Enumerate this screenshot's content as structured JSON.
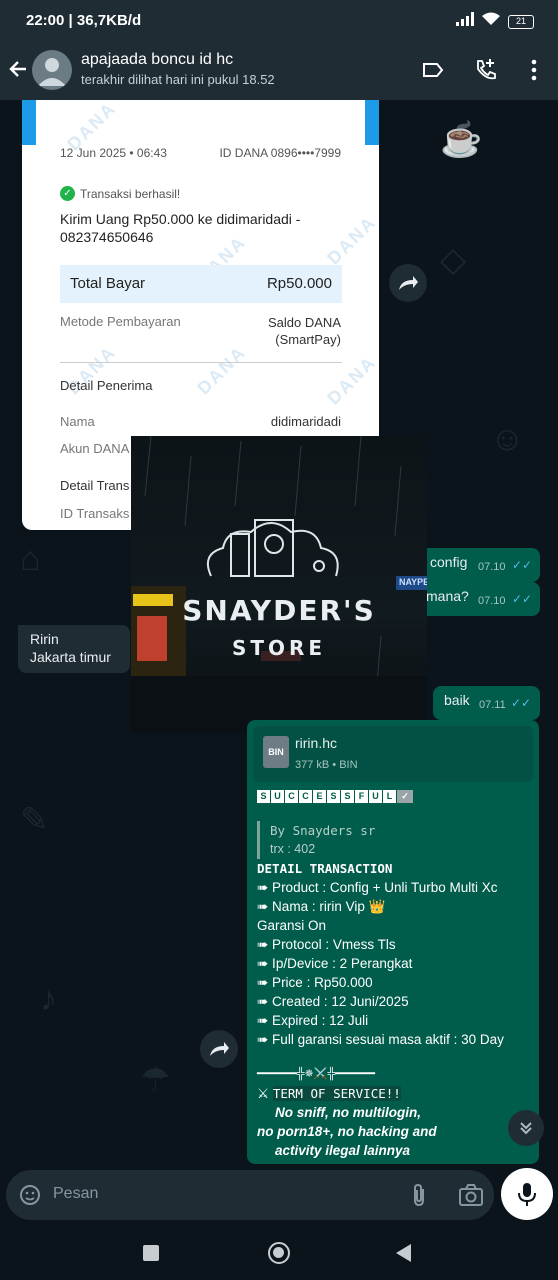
{
  "status_bar": {
    "time": "22:00",
    "speed": "36,7KB/d",
    "battery": "21"
  },
  "header": {
    "contact_name": "apajaada boncu id hc",
    "last_seen": "terakhir dilihat hari ini pukul 18.52"
  },
  "receipt": {
    "date": "12 Jun 2025 • 06:43",
    "id_dana": "ID DANA 0896••••7999",
    "status": "Transaksi berhasil!",
    "description": "Kirim Uang Rp50.000 ke didimaridadi - 082374650646",
    "total_label": "Total Bayar",
    "total_value": "Rp50.000",
    "method_label": "Metode Pembayaran",
    "method_value_1": "Saldo DANA",
    "method_value_2": "(SmartPay)",
    "recipient_heading": "Detail Penerima",
    "name_label": "Nama",
    "name_value": "didimaridadi",
    "account_label": "Akun DANA",
    "transaction_heading": "Detail Trans",
    "transaction_id_label": "ID Transaks",
    "watermark": "DANA"
  },
  "messages": {
    "out1_text": "config",
    "out1_time": "07.10",
    "out2_text": "mana?",
    "out2_time": "07.10",
    "out3_text": "baik",
    "out3_time": "07.11",
    "in1_line1": "Ririn",
    "in1_line2": "Jakarta timur"
  },
  "store_image": {
    "title": "SNAYDER'S",
    "subtitle": "STORE",
    "sign": "NAYPE"
  },
  "file": {
    "icon_label": "BIN",
    "name": "ririn.hc",
    "meta": "377 kB • BIN"
  },
  "detail_message": {
    "success_letters": [
      "S",
      "U",
      "C",
      "C",
      "E",
      "S",
      "S",
      "F",
      "U",
      "L"
    ],
    "by": "By Snayders sr",
    "trx": "trx : 402",
    "heading": "DETAIL TRANSACTION",
    "product": "➠ Product : Config + Unli Turbo Multi Xc",
    "nama": "➠ Nama  : ririn Vip 👑",
    "garansi": "Garansi On",
    "protocol": "➠ Protocol : Vmess Tls",
    "device": "➠ Ip/Device : 2 Perangkat",
    "price": "➠ Price : Rp50.000",
    "created": "➠ Created  : 12 Juni/2025",
    "expired": "➠ Expired : 12 Juli",
    "full_garansi": "➠ Full garansi sesuai masa aktif : 30 Day",
    "divider": "━━━━━━╬✵⚔️╬━━━━━━",
    "tos": "TERM OF SERVICE!!",
    "rule1": "No sniff, no multilogin,",
    "rule2": "no porn18+, no hacking and",
    "rule3": "activity ilegal lainnya"
  },
  "composer": {
    "placeholder": "Pesan"
  },
  "colors": {
    "header_bg": "#1f2c34",
    "chat_bg": "#0b141a",
    "outgoing_bubble": "#005c4b",
    "incoming_bubble": "#1f2c34",
    "read_ticks": "#53bdeb",
    "dana_blue": "#1d9be8"
  },
  "icons": [
    "back-arrow-icon",
    "label-icon",
    "add-call-icon",
    "more-vert-icon",
    "forward-icon",
    "sticker-icon",
    "attach-icon",
    "camera-icon",
    "mic-icon",
    "scroll-down-icon",
    "nav-recents-icon",
    "nav-home-icon",
    "nav-back-icon"
  ]
}
